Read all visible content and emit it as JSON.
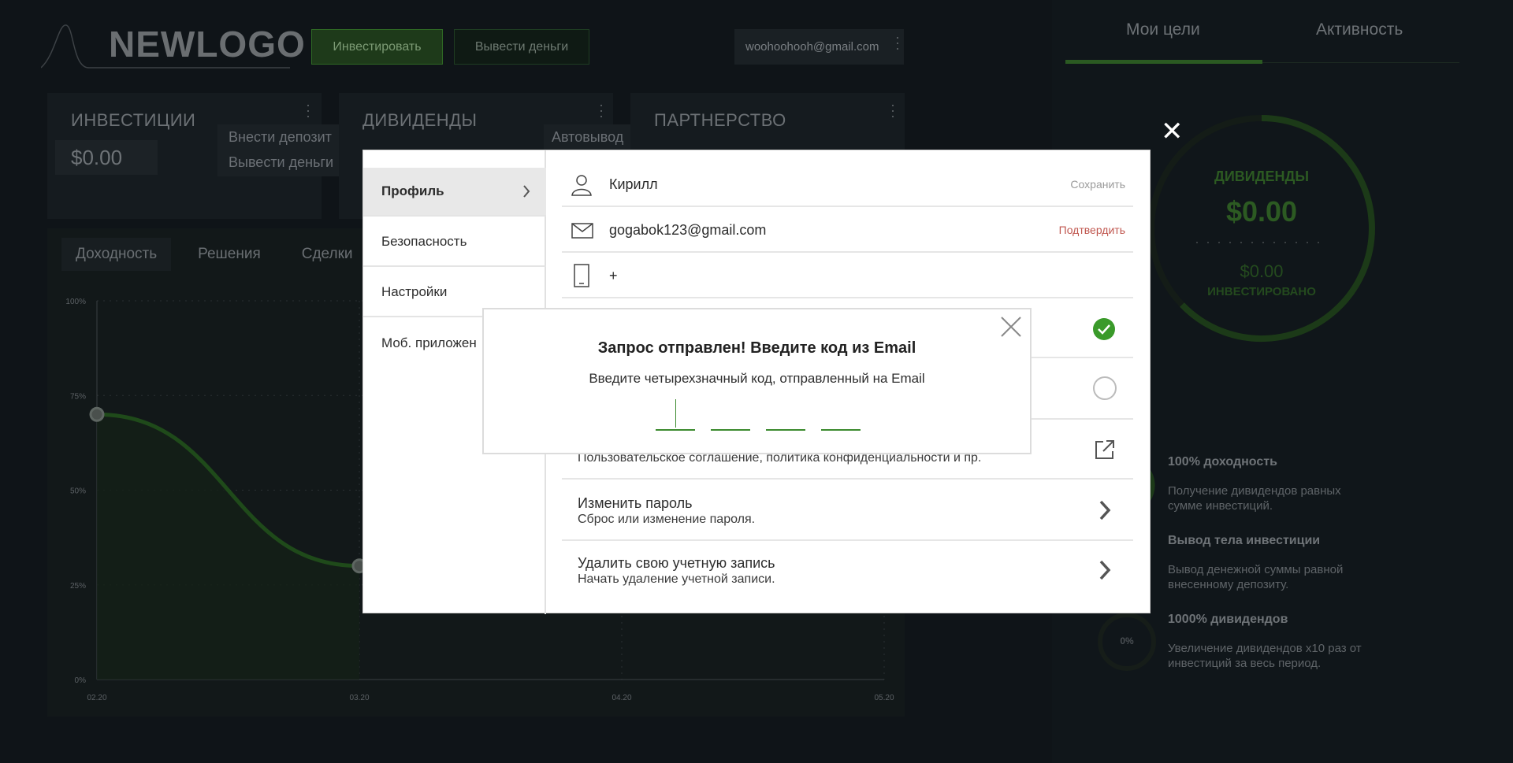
{
  "header": {
    "logo_text": "NEWLOGO",
    "invest_button": "Инвестировать",
    "withdraw_button": "Вывести деньги",
    "user_email": "woohoohooh@gmail.com"
  },
  "cards": [
    {
      "title": "ИНВЕСТИЦИИ",
      "value": "$0.00",
      "menu": [
        "Внести депозит",
        "Вывести деньги"
      ]
    },
    {
      "title": "ДИВИДЕНДЫ",
      "menu": [
        "Автовывод"
      ]
    },
    {
      "title": "ПАРТНЕРСТВО"
    }
  ],
  "chart_tabs": [
    "Доходность",
    "Решения",
    "Сделки"
  ],
  "chart_data": {
    "type": "line",
    "x": [
      "02.20",
      "03.20",
      "04.20",
      "05.20"
    ],
    "y_ticks": [
      "0%",
      "25%",
      "50%",
      "75%",
      "100%"
    ],
    "ylim": [
      0,
      100
    ],
    "series": [
      {
        "values": [
          70,
          30
        ]
      }
    ],
    "grid": true
  },
  "right_panel": {
    "tabs": [
      "Мои цели",
      "Активность"
    ],
    "gauge_title": "ДИВИДЕНДЫ",
    "gauge_value": "$0.00",
    "gauge_sub_value": "$0.00",
    "gauge_sub_label": "ИНВЕСТИРОВАНО",
    "small_gauge_value": "0%",
    "goals": [
      {
        "title": "100% доходность",
        "desc": "Получение дивидендов равных сумме инвестиций."
      },
      {
        "title": "Вывод тела инвестиции",
        "desc": "Вывод денежной суммы равной внесенному депозиту."
      },
      {
        "title": "1000% дивидендов",
        "desc": "Увеличение дивидендов x10 раз от инвестиций за весь период."
      }
    ]
  },
  "modal": {
    "nav": [
      "Профиль",
      "Безопасность",
      "Настройки",
      "Моб. приложен"
    ],
    "name_field": {
      "value": "Кирилл",
      "action": "Сохранить"
    },
    "email_field": {
      "value": "gogabok123@gmail.com",
      "action": "Подтвердить"
    },
    "phone_field": {
      "value": "+"
    },
    "rows": [
      {
        "sub": "Пользовательское соглашение, политика конфиденциальности и пр."
      },
      {
        "title": "Изменить пароль",
        "sub": "Сброс или изменение пароля."
      },
      {
        "title": "Удалить свою учетную запись",
        "sub": "Начать удаление учетной записи."
      }
    ],
    "colors": {
      "accent": "#3a9a2a",
      "confirm": "#c0574f",
      "save": "#9a9a9a"
    }
  },
  "code_dialog": {
    "title": "Запрос отправлен! Введите код из Email",
    "subtitle": "Введите четырехзначный код, отправленный на Email",
    "digits": 4
  }
}
